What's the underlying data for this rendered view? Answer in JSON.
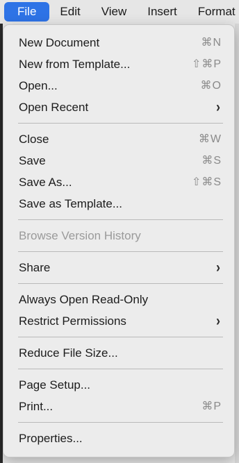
{
  "menubar": {
    "items": [
      "File",
      "Edit",
      "View",
      "Insert",
      "Format"
    ]
  },
  "menu": {
    "new_document": {
      "label": "New Document",
      "shortcut": "⌘N"
    },
    "new_from_template": {
      "label": "New from Template...",
      "shortcut": "⇧⌘P"
    },
    "open": {
      "label": "Open...",
      "shortcut": "⌘O"
    },
    "open_recent": {
      "label": "Open Recent"
    },
    "close": {
      "label": "Close",
      "shortcut": "⌘W"
    },
    "save": {
      "label": "Save",
      "shortcut": "⌘S"
    },
    "save_as": {
      "label": "Save As...",
      "shortcut": "⇧⌘S"
    },
    "save_as_template": {
      "label": "Save as Template..."
    },
    "browse_version_history": {
      "label": "Browse Version History"
    },
    "share": {
      "label": "Share"
    },
    "always_open_read_only": {
      "label": "Always Open Read-Only"
    },
    "restrict_permissions": {
      "label": "Restrict Permissions"
    },
    "reduce_file_size": {
      "label": "Reduce File Size..."
    },
    "page_setup": {
      "label": "Page Setup..."
    },
    "print": {
      "label": "Print...",
      "shortcut": "⌘P"
    },
    "properties": {
      "label": "Properties..."
    }
  },
  "colors": {
    "accent": "#2e73e6",
    "menu_bg": "#ececec",
    "disabled_text": "#9a9a9a"
  }
}
